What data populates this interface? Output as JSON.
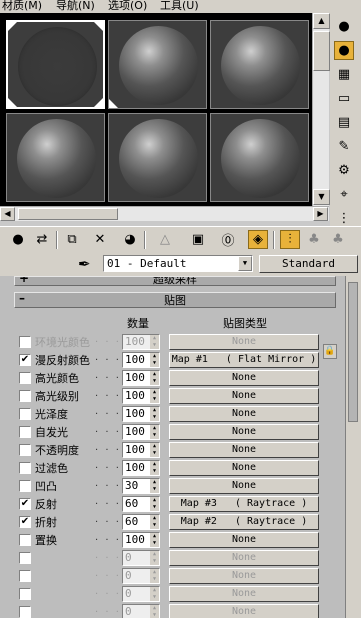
{
  "menu": [
    "材质(M)",
    "导航(N)",
    "选项(O)",
    "工具(U)"
  ],
  "slots": [
    {
      "id": "slot-1",
      "state": "empty",
      "selected": true
    },
    {
      "id": "slot-2",
      "state": "sphere",
      "selected": false
    },
    {
      "id": "slot-3",
      "state": "sphere",
      "selected": false
    },
    {
      "id": "slot-4",
      "state": "sphere",
      "selected": false
    },
    {
      "id": "slot-5",
      "state": "sphere",
      "selected": false
    },
    {
      "id": "slot-6",
      "state": "sphere",
      "selected": false
    }
  ],
  "material": {
    "name": "01 - Default",
    "type": "Standard"
  },
  "rollouts": {
    "collapsed_label": "超级采样",
    "maps_label": "贴图",
    "collapsed_toggle": "+",
    "maps_toggle": "–"
  },
  "maps_header": {
    "amount": "数量",
    "map_type": "贴图类型"
  },
  "maps": [
    {
      "label": "环境光颜色",
      "checked": false,
      "amount": "100",
      "map": "None",
      "dim": true
    },
    {
      "label": "漫反射颜色",
      "checked": true,
      "amount": "100",
      "map": "Map #1   ( Flat Mirror )",
      "dim": false
    },
    {
      "label": "高光颜色",
      "checked": false,
      "amount": "100",
      "map": "None",
      "dim": false
    },
    {
      "label": "高光级别",
      "checked": false,
      "amount": "100",
      "map": "None",
      "dim": false
    },
    {
      "label": "光泽度",
      "checked": false,
      "amount": "100",
      "map": "None",
      "dim": false
    },
    {
      "label": "自发光",
      "checked": false,
      "amount": "100",
      "map": "None",
      "dim": false
    },
    {
      "label": "不透明度",
      "checked": false,
      "amount": "100",
      "map": "None",
      "dim": false
    },
    {
      "label": "过滤色",
      "checked": false,
      "amount": "100",
      "map": "None",
      "dim": false
    },
    {
      "label": "凹凸",
      "checked": false,
      "amount": "30",
      "map": "None",
      "dim": false
    },
    {
      "label": "反射",
      "checked": true,
      "amount": "60",
      "map": "Map #3   ( Raytrace )",
      "dim": false
    },
    {
      "label": "折射",
      "checked": true,
      "amount": "60",
      "map": "Map #2   ( Raytrace )",
      "dim": false
    },
    {
      "label": "置换",
      "checked": false,
      "amount": "100",
      "map": "None",
      "dim": false
    },
    {
      "label": "",
      "checked": false,
      "amount": "0",
      "map": "None",
      "dim": true
    },
    {
      "label": "",
      "checked": false,
      "amount": "0",
      "map": "None",
      "dim": true
    },
    {
      "label": "",
      "checked": false,
      "amount": "0",
      "map": "None",
      "dim": true
    },
    {
      "label": "",
      "checked": false,
      "amount": "0",
      "map": "None",
      "dim": true
    }
  ],
  "colors": {
    "active_button": "#e8b23a",
    "slot_bg": "#3d3d3d"
  }
}
